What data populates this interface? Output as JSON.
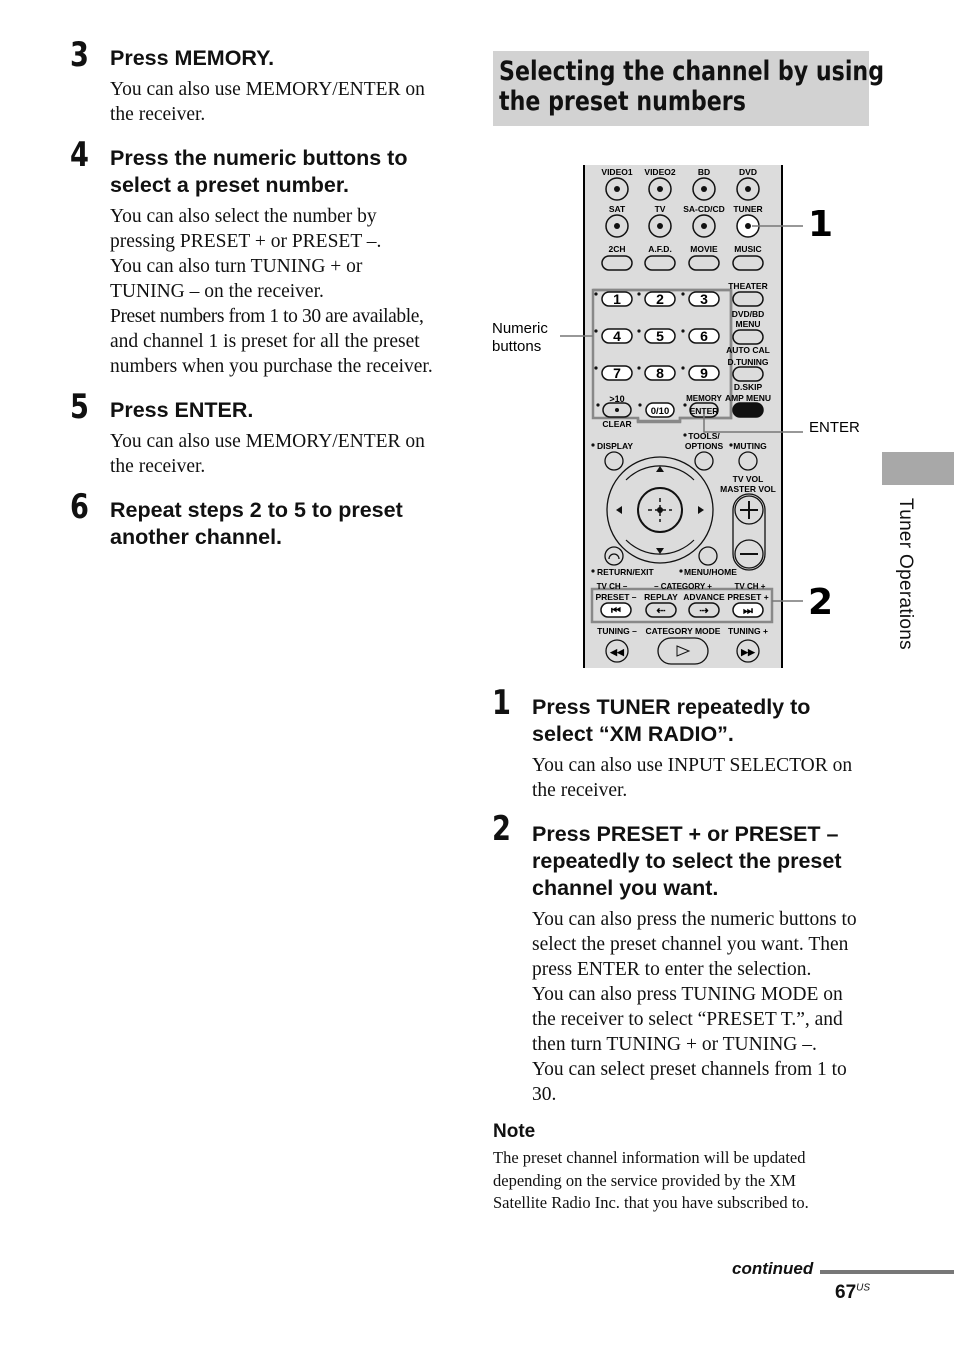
{
  "left": {
    "steps": [
      {
        "num": "3",
        "title": "Press MEMORY.",
        "body": [
          "You can also use MEMORY/ENTER on",
          "the receiver."
        ]
      },
      {
        "num": "4",
        "title": [
          "Press the numeric buttons to",
          "select a preset number."
        ],
        "body": [
          "You can also select the number by",
          "pressing PRESET + or PRESET –.",
          "You can also turn TUNING + or",
          "TUNING – on the receiver.",
          "Preset numbers from 1 to 30 are available,",
          "and channel 1 is preset for all the preset",
          "numbers when you purchase the receiver."
        ]
      },
      {
        "num": "5",
        "title": "Press ENTER.",
        "body": [
          "You can also use MEMORY/ENTER on",
          "the receiver."
        ]
      },
      {
        "num": "6",
        "title": [
          "Repeat steps 2 to 5 to preset",
          "another channel."
        ]
      }
    ]
  },
  "section": {
    "title": [
      "Selecting the channel by using",
      "the preset numbers"
    ]
  },
  "figure": {
    "callouts": {
      "one": "1",
      "two": "2",
      "enter": "ENTER",
      "numeric": [
        "Numeric",
        "buttons"
      ]
    },
    "remote": {
      "video1": "VIDEO1",
      "video2": "VIDEO2",
      "bd": "BD",
      "dvd": "DVD",
      "sat": "SAT",
      "tv": "TV",
      "sacd": "SA-CD/CD",
      "tuner": "TUNER",
      "ch2": "2CH",
      "afd": "A.F.D.",
      "movie": "MOVIE",
      "music": "MUSIC",
      "theater": "THEATER",
      "dvdbd": "DVD/BD",
      "menu": "MENU",
      "autocal": "AUTO CAL",
      "dtuning": "D.TUNING",
      "dskip": "D.SKIP",
      "ampmenu": "AMP MENU",
      "n1": "1",
      "n2": "2",
      "n3": "3",
      "n4": "4",
      "n5": "5",
      "n6": "6",
      "n7": "7",
      "n8": "8",
      "n9": "9",
      "n0": "0/10",
      "gt10": ">10",
      "clear": "CLEAR",
      "memory": "MEMORY",
      "enter": "ENTER",
      "display": "DISPLAY",
      "tools": "TOOLS/",
      "options": "OPTIONS",
      "muting": "MUTING",
      "tvvol": "TV VOL",
      "mastervol": "MASTER VOL",
      "returnexit": "RETURN/EXIT",
      "menuhome": "MENU/HOME",
      "tvchminus": "TV CH –",
      "category": "– CATEGORY +",
      "tvchplus": "TV CH +",
      "presetminus": "PRESET –",
      "replay": "REPLAY",
      "advance": "ADVANCE",
      "presetplus": "PRESET +",
      "tuningminus": "TUNING –",
      "categorymode": "CATEGORY MODE",
      "tuningplus": "TUNING +"
    }
  },
  "right": {
    "steps": [
      {
        "num": "1",
        "title": [
          "Press TUNER repeatedly to",
          "select “XM RADIO”."
        ],
        "body": [
          "You can also use INPUT SELECTOR on",
          "the receiver."
        ]
      },
      {
        "num": "2",
        "title": [
          "Press PRESET + or PRESET –",
          "repeatedly to select the preset",
          "channel you want."
        ],
        "body": [
          "You can also press the numeric buttons to",
          "select the preset channel you want. Then",
          "press ENTER to enter the selection.",
          "You can also press TUNING MODE on",
          "the receiver to select “PRESET T.”, and",
          "then turn TUNING + or TUNING –.",
          "You can select preset channels from 1 to",
          "30."
        ]
      }
    ],
    "note": {
      "title": "Note",
      "body": [
        "The preset channel information will be updated",
        "depending on the service provided by the XM",
        "Satellite Radio Inc. that you have subscribed to."
      ]
    }
  },
  "side_tab": "Tuner Operations",
  "footer": {
    "continued": "continued",
    "page": "67",
    "suffix": "US"
  }
}
